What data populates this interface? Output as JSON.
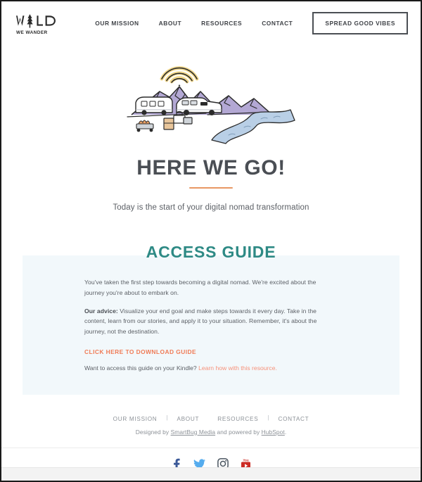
{
  "site": {
    "logo_main": "WILD",
    "logo_sub": "WE WANDER",
    "logo_icon": "pine-tree-icon"
  },
  "header": {
    "nav": [
      {
        "label": "OUR MISSION"
      },
      {
        "label": "ABOUT"
      },
      {
        "label": "RESOURCES"
      },
      {
        "label": "CONTACT"
      }
    ],
    "cta_label": "SPREAD GOOD VIBES"
  },
  "hero": {
    "illustration_name": "mountain-camper-wifi-illustration",
    "title": "HERE WE GO!",
    "subtitle": "Today is the start of your digital nomad transformation"
  },
  "guide": {
    "title": "ACCESS GUIDE",
    "paragraph_1": "You've taken the first step towards becoming a digital nomad. We're excited about the journey you're about to embark on.",
    "advice_label": "Our advice:",
    "advice_text": " Visualize your end goal and make steps towards it every day. Take in the content, learn from our stories, and apply it to your situation. Remember, it's about the journey, not the destination.",
    "download_label": "CLICK HERE TO DOWNLOAD GUIDE",
    "kindle_text": "Want to access this guide on your Kindle? ",
    "kindle_link": "Learn how with this resource."
  },
  "footer": {
    "nav": [
      {
        "label": "OUR MISSION"
      },
      {
        "label": "ABOUT"
      },
      {
        "label": "RESOURCES"
      },
      {
        "label": "CONTACT"
      }
    ],
    "separator": "|",
    "credit_prefix": "Designed by ",
    "credit_link_1": "SmartBug Media",
    "credit_middle": " and powered by ",
    "credit_link_2": "HubSpot",
    "credit_suffix": ".",
    "social": [
      {
        "name": "facebook-icon",
        "color": "#3b5998"
      },
      {
        "name": "twitter-icon",
        "color": "#55acee"
      },
      {
        "name": "instagram-icon",
        "color": "#4a5560"
      },
      {
        "name": "youtube-icon",
        "color": "#cc2b24"
      }
    ]
  },
  "colors": {
    "heading_dark": "#4a4e54",
    "accent_orange": "#e89763",
    "teal": "#2e8a85",
    "cta_orange": "#f07b56",
    "link_salmon": "#f79179",
    "panel_bg": "#f2f8fb",
    "mountain_purple": "#b3a8d4",
    "river_blue": "#b9cfe6",
    "wifi_gold": "#f2d88c"
  }
}
